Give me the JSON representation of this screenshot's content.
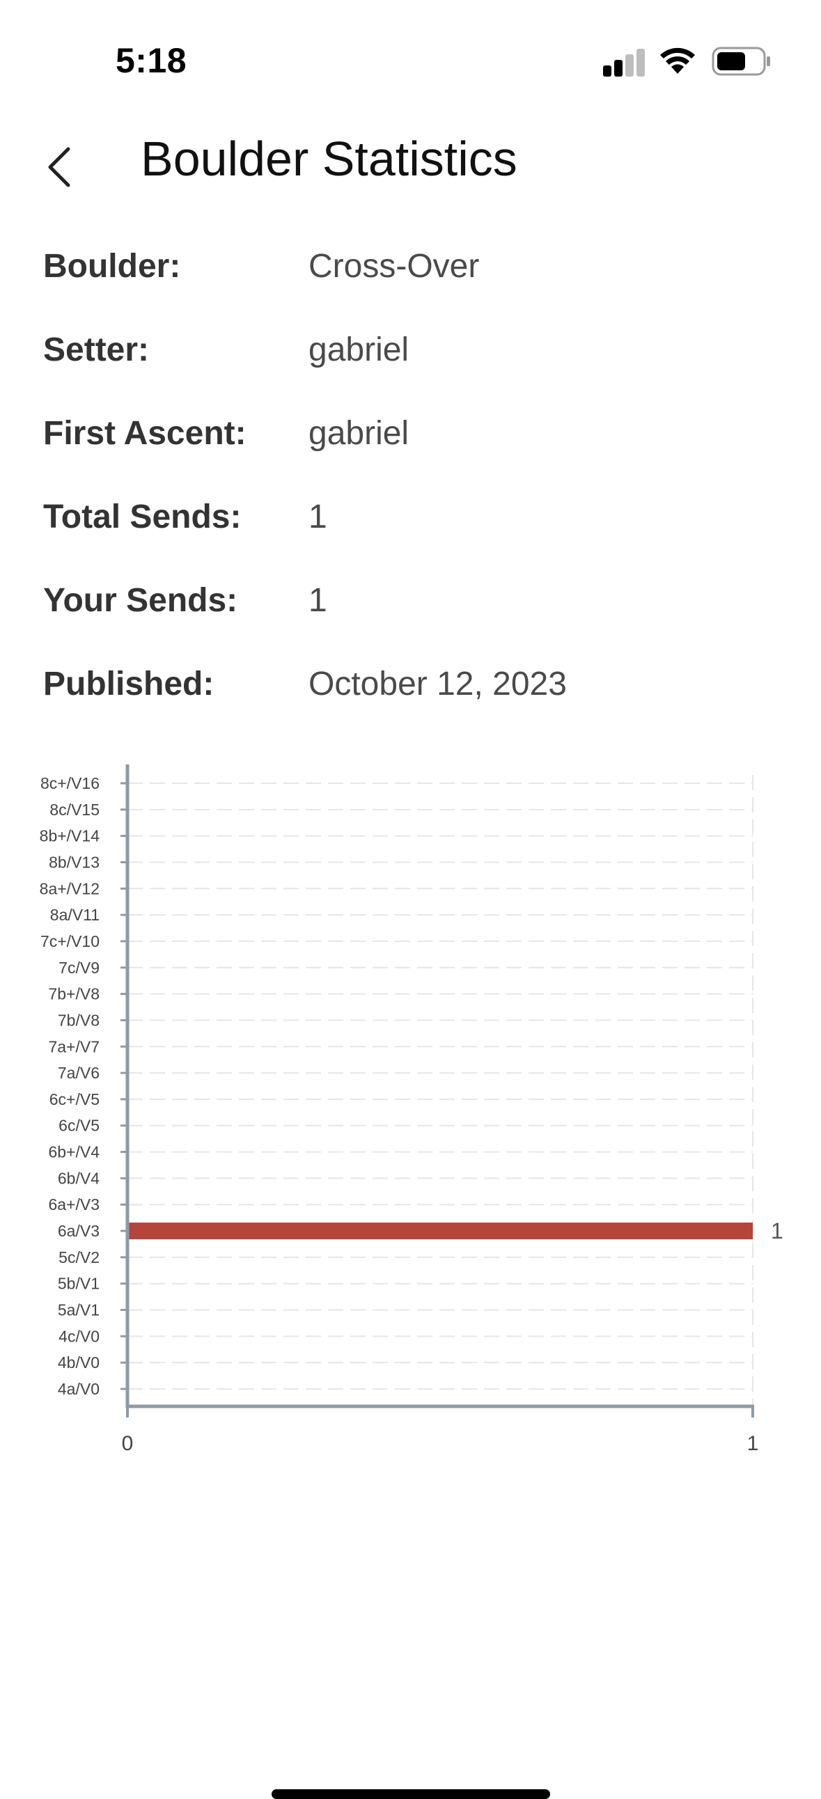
{
  "status_bar": {
    "time": "5:18"
  },
  "header": {
    "title": "Boulder Statistics"
  },
  "stats": [
    {
      "label": "Boulder:",
      "value": "Cross-Over"
    },
    {
      "label": "Setter:",
      "value": "gabriel"
    },
    {
      "label": "First Ascent:",
      "value": "gabriel"
    },
    {
      "label": "Total Sends:",
      "value": "1"
    },
    {
      "label": "Your Sends:",
      "value": "1"
    },
    {
      "label": "Published:",
      "value": "October 12, 2023"
    }
  ],
  "colors": {
    "bar": "#b5443a",
    "axis": "#8e9aa6",
    "grid": "#e6e6e6"
  },
  "chart_data": {
    "type": "bar",
    "orientation": "horizontal",
    "categories": [
      "4a/V0",
      "4b/V0",
      "4c/V0",
      "5a/V1",
      "5b/V1",
      "5c/V2",
      "6a/V3",
      "6a+/V3",
      "6b/V4",
      "6b+/V4",
      "6c/V5",
      "6c+/V5",
      "7a/V6",
      "7a+/V7",
      "7b/V8",
      "7b+/V8",
      "7c/V9",
      "7c+/V10",
      "8a/V11",
      "8a+/V12",
      "8b/V13",
      "8b+/V14",
      "8c/V15",
      "8c+/V16"
    ],
    "values": [
      0,
      0,
      0,
      0,
      0,
      0,
      1,
      0,
      0,
      0,
      0,
      0,
      0,
      0,
      0,
      0,
      0,
      0,
      0,
      0,
      0,
      0,
      0,
      0
    ],
    "data_labels": [
      "",
      "",
      "",
      "",
      "",
      "",
      "1",
      "",
      "",
      "",
      "",
      "",
      "",
      "",
      "",
      "",
      "",
      "",
      "",
      "",
      "",
      "",
      "",
      ""
    ],
    "xlim": [
      0,
      1
    ],
    "xticks": [
      "0",
      "1"
    ],
    "grid": true
  }
}
